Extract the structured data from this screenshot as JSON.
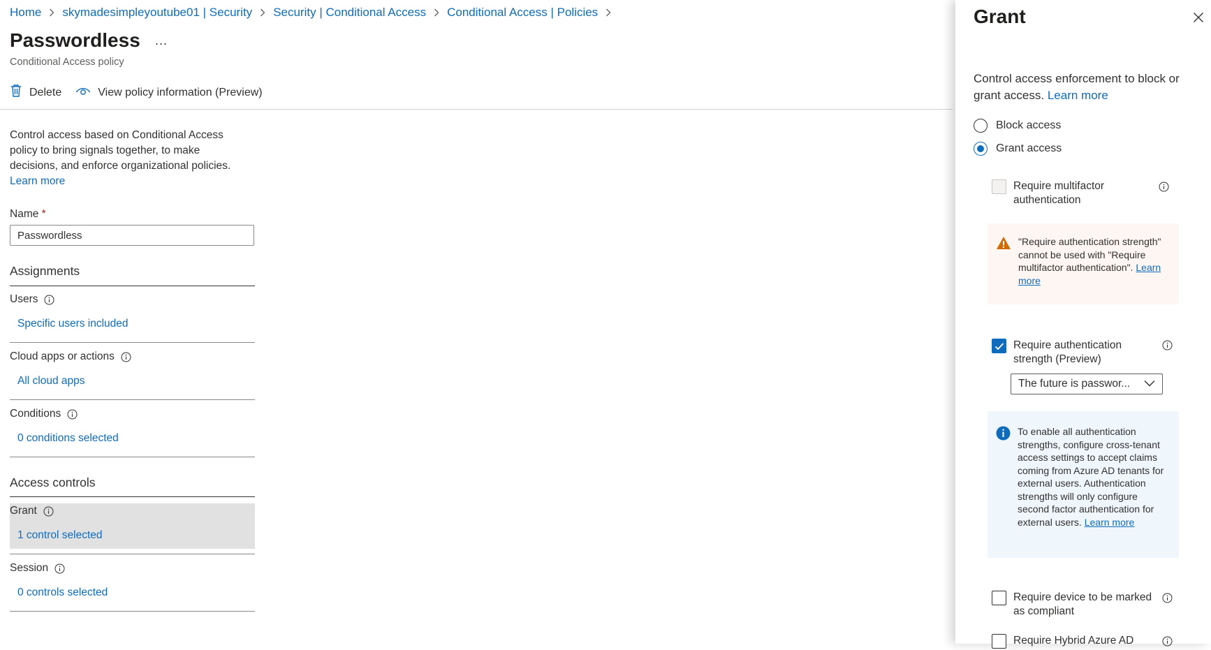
{
  "breadcrumb": {
    "items": [
      "Home",
      "skymadesimpleyoutube01 | Security",
      "Security | Conditional Access",
      "Conditional Access | Policies"
    ]
  },
  "page": {
    "title": "Passwordless",
    "more": "...",
    "subtitle": "Conditional Access policy"
  },
  "toolbar": {
    "delete_label": "Delete",
    "view_info_label": "View policy information (Preview)"
  },
  "intro": {
    "text": "Control access based on Conditional Access policy to bring signals together, to make decisions, and enforce organizational policies.",
    "learn_more": "Learn more"
  },
  "name_field": {
    "label": "Name",
    "required_mark": "*",
    "value": "Passwordless"
  },
  "assignments": {
    "heading": "Assignments",
    "users_label": "Users",
    "users_value": "Specific users included",
    "cloud_apps_label": "Cloud apps or actions",
    "cloud_apps_value": "All cloud apps",
    "conditions_label": "Conditions",
    "conditions_value": "0 conditions selected"
  },
  "access_controls": {
    "heading": "Access controls",
    "grant_label": "Grant",
    "grant_value": "1 control selected",
    "session_label": "Session",
    "session_value": "0 controls selected"
  },
  "grant_panel": {
    "title": "Grant",
    "description": "Control access enforcement to block or grant access.",
    "learn_more": "Learn more",
    "block_access": "Block access",
    "grant_access": "Grant access",
    "selected_option": "Grant access",
    "mfa_label": "Require multifactor authentication",
    "warning_text": "\"Require authentication strength\" cannot be used with \"Require multifactor authentication\".",
    "warning_link": "Learn more",
    "auth_strength_label": "Require authentication strength (Preview)",
    "auth_strength_value": "The future is passwor...",
    "info_text": "To enable all authentication strengths, configure cross-tenant access settings to accept claims coming from Azure AD tenants for external users. Authentication strengths will only configure second factor authentication for external users.",
    "info_link": "Learn more",
    "compliant_label": "Require device to be marked as compliant",
    "hybrid_label": "Require Hybrid Azure AD"
  },
  "colors": {
    "accent": "#0f6cbd",
    "warning": "#d26b00",
    "required": "#a4262c"
  }
}
